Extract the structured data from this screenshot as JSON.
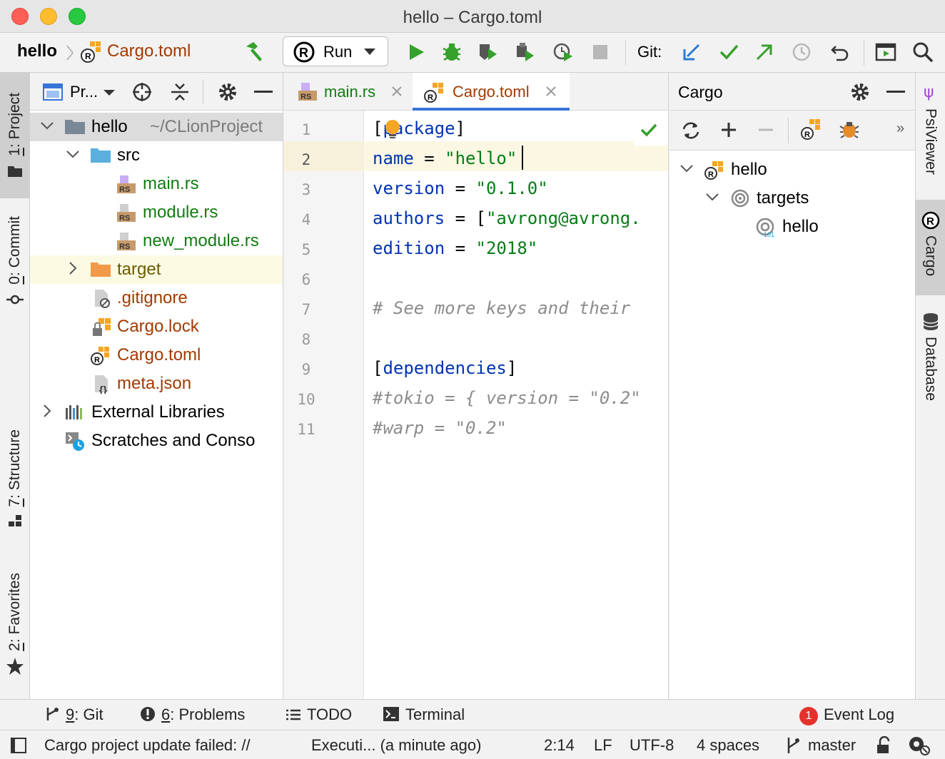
{
  "window": {
    "title": "hello – Cargo.toml"
  },
  "nav": {
    "project": "hello",
    "file": "Cargo.toml",
    "run_config": "Run",
    "git_label": "Git:"
  },
  "left_stripe": {
    "project_num": "1",
    "project_label": ": Project",
    "commit_num": "0",
    "commit_label": ": Commit",
    "structure_num": "7",
    "structure_label": ": Structure",
    "favorites_num": "2",
    "favorites_label": ": Favorites"
  },
  "project_panel": {
    "view_label": "Pr...",
    "tree": [
      {
        "name": "hello",
        "path": "~/CLionProject"
      },
      {
        "name": "src"
      },
      {
        "name": "main.rs"
      },
      {
        "name": "module.rs"
      },
      {
        "name": "new_module.rs"
      },
      {
        "name": "target"
      },
      {
        "name": ".gitignore"
      },
      {
        "name": "Cargo.lock"
      },
      {
        "name": "Cargo.toml"
      },
      {
        "name": "meta.json"
      },
      {
        "name": "External Libraries"
      },
      {
        "name": "Scratches and Conso"
      }
    ]
  },
  "editor": {
    "tabs": [
      {
        "label": "main.rs"
      },
      {
        "label": "Cargo.toml"
      }
    ],
    "line_numbers": [
      "1",
      "2",
      "3",
      "4",
      "5",
      "6",
      "7",
      "8",
      "9",
      "10",
      "11"
    ],
    "lines": [
      [
        {
          "t": "[",
          "c": "p"
        },
        {
          "t": "package",
          "c": "k"
        },
        {
          "t": "]",
          "c": "p"
        }
      ],
      [
        {
          "t": "name",
          "c": "k"
        },
        {
          "t": " = ",
          "c": "p"
        },
        {
          "t": "\"hello\"",
          "c": "s"
        }
      ],
      [
        {
          "t": "version",
          "c": "k"
        },
        {
          "t": " = ",
          "c": "p"
        },
        {
          "t": "\"0.1.0\"",
          "c": "s"
        }
      ],
      [
        {
          "t": "authors",
          "c": "k"
        },
        {
          "t": " = [",
          "c": "p"
        },
        {
          "t": "\"avrong@avrong.",
          "c": "s"
        }
      ],
      [
        {
          "t": "edition",
          "c": "k"
        },
        {
          "t": " = ",
          "c": "p"
        },
        {
          "t": "\"2018\"",
          "c": "s"
        }
      ],
      [],
      [
        {
          "t": "# See more keys and their",
          "c": "c"
        }
      ],
      [],
      [
        {
          "t": "[",
          "c": "p"
        },
        {
          "t": "dependencies",
          "c": "k"
        },
        {
          "t": "]",
          "c": "p"
        }
      ],
      [
        {
          "t": "#tokio = { version = \"0.2\"",
          "c": "c"
        }
      ],
      [
        {
          "t": "#warp = \"0.2\"",
          "c": "c"
        }
      ]
    ]
  },
  "cargo_panel": {
    "title": "Cargo",
    "tree": [
      {
        "name": "hello"
      },
      {
        "name": "targets"
      },
      {
        "name": "hello"
      }
    ]
  },
  "right_stripe": {
    "psi": "PsiViewer",
    "cargo": "Cargo",
    "database": "Database"
  },
  "tool_windows": {
    "git_num": "9",
    "git_label": ": Git",
    "problems_num": "6",
    "problems_label": ": Problems",
    "todo": "TODO",
    "terminal": "Terminal",
    "event_count": "1",
    "event_log": "Event Log"
  },
  "status": {
    "message": "Cargo project update failed: //",
    "task": "Executi... (a minute ago)",
    "position": "2:14",
    "line_sep": "LF",
    "encoding": "UTF-8",
    "indent": "4 spaces",
    "branch": "master"
  },
  "colors": {
    "accent_blue": "#3874d8",
    "run_green": "#35a12b",
    "file_modified": "#a33a00",
    "file_added": "#127c12",
    "target_highlight": "#fbfbe3"
  }
}
